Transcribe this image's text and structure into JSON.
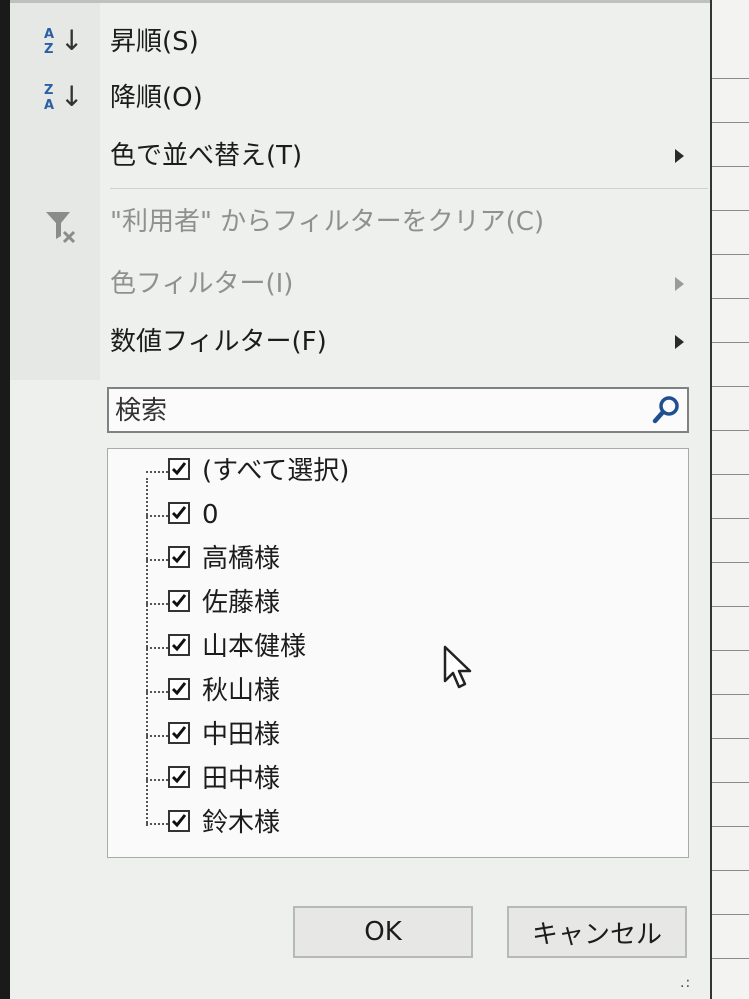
{
  "menu": {
    "sort_asc": "昇順(S)",
    "sort_desc": "降順(O)",
    "sort_by_color": "色で並べ替え(T)",
    "clear_filter": "\"利用者\" からフィルターをクリア(C)",
    "color_filter": "色フィルター(I)",
    "number_filter": "数値フィルター(F)"
  },
  "sort_icons": {
    "asc": {
      "top": "A",
      "bottom": "Z"
    },
    "desc": {
      "top": "Z",
      "bottom": "A"
    }
  },
  "search": {
    "placeholder": "検索"
  },
  "filter_list": {
    "items": [
      {
        "label": "(すべて選択)",
        "checked": true
      },
      {
        "label": "0",
        "checked": true
      },
      {
        "label": "高橋様",
        "checked": true
      },
      {
        "label": "佐藤様",
        "checked": true
      },
      {
        "label": "山本健様",
        "checked": true
      },
      {
        "label": "秋山様",
        "checked": true
      },
      {
        "label": "中田様",
        "checked": true
      },
      {
        "label": "田中様",
        "checked": true
      },
      {
        "label": "鈴木様",
        "checked": true
      }
    ]
  },
  "buttons": {
    "ok": "OK",
    "cancel": "キャンセル"
  },
  "colors": {
    "accent": "#2b5fa5",
    "disabled_text": "#8f9190",
    "menu_bg": "#eef0ed"
  }
}
